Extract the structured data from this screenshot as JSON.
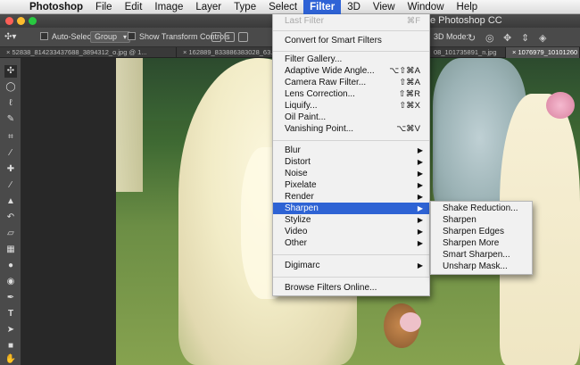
{
  "app": "Photoshop",
  "menubar": {
    "items": [
      "File",
      "Edit",
      "Image",
      "Layer",
      "Type",
      "Select",
      "Filter",
      "3D",
      "View",
      "Window",
      "Help"
    ],
    "active": "Filter"
  },
  "window": {
    "title": "e Photoshop CC"
  },
  "options_bar": {
    "auto_select_label": "Auto-Select:",
    "auto_select_value": "Group",
    "show_transform_label": "Show Transform Controls",
    "mode_3d_label": "3D Mode:"
  },
  "tabs": [
    "52838_814233437688_3894312_o.jpg @ 1...",
    "162889_833886383028_63...",
    "08_101735891_n.jpg",
    "1076979_10101260"
  ],
  "filter_menu": {
    "last_filter": {
      "label": "Last Filter",
      "shortcut": "⌘F"
    },
    "convert": "Convert for Smart Filters",
    "group1": [
      {
        "label": "Filter Gallery...",
        "shortcut": ""
      },
      {
        "label": "Adaptive Wide Angle...",
        "shortcut": "⌥⇧⌘A"
      },
      {
        "label": "Camera Raw Filter...",
        "shortcut": "⇧⌘A"
      },
      {
        "label": "Lens Correction...",
        "shortcut": "⇧⌘R"
      },
      {
        "label": "Liquify...",
        "shortcut": "⇧⌘X"
      },
      {
        "label": "Oil Paint...",
        "shortcut": ""
      },
      {
        "label": "Vanishing Point...",
        "shortcut": "⌥⌘V"
      }
    ],
    "group2": [
      "Blur",
      "Distort",
      "Noise",
      "Pixelate",
      "Render",
      "Sharpen",
      "Stylize",
      "Video",
      "Other"
    ],
    "highlighted": "Sharpen",
    "digimarc": "Digimarc",
    "browse": "Browse Filters Online..."
  },
  "sharpen_submenu": [
    "Shake Reduction...",
    "Sharpen",
    "Sharpen Edges",
    "Sharpen More",
    "Smart Sharpen...",
    "Unsharp Mask..."
  ],
  "colors": {
    "menu_highlight": "#2e63d4",
    "menu_bg": "#f1f1f1",
    "ps_panel": "#4a4a4a"
  },
  "icons": {
    "apple": "apple-logo-icon",
    "tools": [
      "move-icon",
      "marquee-icon",
      "lasso-icon",
      "quick-select-icon",
      "crop-icon",
      "eyedropper-icon",
      "healing-icon",
      "brush-icon",
      "stamp-icon",
      "history-brush-icon",
      "eraser-icon",
      "gradient-icon",
      "blur-icon",
      "dodge-icon",
      "pen-icon",
      "type-icon",
      "path-select-icon",
      "shape-icon",
      "hand-icon"
    ]
  }
}
